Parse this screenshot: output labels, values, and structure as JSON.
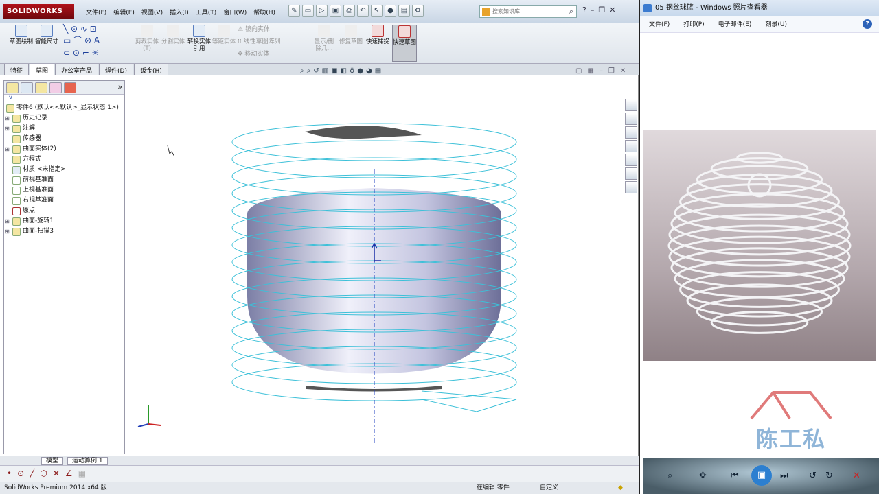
{
  "solidworks": {
    "logo": "SOLIDWORKS",
    "menu": [
      "文件(F)",
      "编辑(E)",
      "视图(V)",
      "插入(I)",
      "工具(T)",
      "窗口(W)",
      "帮助(H)"
    ],
    "search_placeholder": "搜索知识库",
    "cmd": {
      "sketch": "草图绘制",
      "smartdim": "智能尺寸",
      "trim": "剪裁实体(T)",
      "split": "分割实体",
      "convert": "转换实体引用",
      "offset": "等距实体",
      "mirror": "镜向实体",
      "linpattern": "线性草图阵列",
      "move": "移动实体",
      "showdel": "显示/删除几...",
      "repair": "修复草图",
      "snap": "快速捕捉",
      "rapid": "快速草图"
    },
    "tabs": [
      "特征",
      "草图",
      "办公室产品",
      "焊件(D)",
      "钣金(H)"
    ],
    "tree": {
      "root": "零件6 (默认<<默认>_显示状态 1>)",
      "items": [
        "历史记录",
        "注解",
        "传感器",
        "曲面实体(2)",
        "方程式",
        "材质 <未指定>",
        "前视基准面",
        "上视基准面",
        "右视基准面",
        "原点",
        "曲面-旋转1",
        "曲面-扫描3"
      ]
    },
    "bottom_tabs": [
      "模型",
      "运动算例 1"
    ],
    "status": {
      "version": "SolidWorks Premium 2014 x64 版",
      "editing": "在编辑 零件",
      "custom": "自定义"
    }
  },
  "viewer": {
    "title": "05 钢丝球篮 - Windows 照片查看器",
    "menu": [
      "文件(F)",
      "打印(P)",
      "电子邮件(E)",
      "刻录(U)"
    ],
    "help": "?",
    "watermark": "陈工私塾"
  },
  "colors": {
    "edge": "#3cc0d8",
    "surface": "#b3b4d6",
    "accent": "#b0121b"
  }
}
